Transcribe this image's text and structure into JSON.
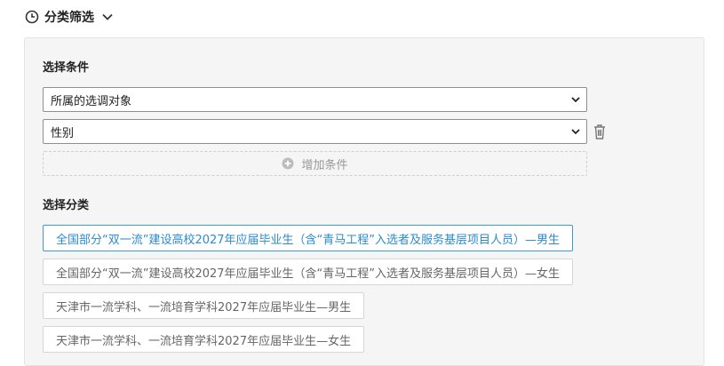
{
  "header": {
    "title": "分类筛选",
    "icon": "clock-icon",
    "toggle_icon": "chevron-down-icon"
  },
  "conditions": {
    "title": "选择条件",
    "selects": [
      {
        "value": "所属的选调对象"
      },
      {
        "value": "性别"
      }
    ],
    "add_label": "增加条件"
  },
  "categories": {
    "title": "选择分类",
    "items": [
      {
        "label": "全国部分“双一流”建设高校2027年应届毕业生（含“青马工程”入选者及服务基层项目人员）—男生",
        "selected": true
      },
      {
        "label": "全国部分“双一流”建设高校2027年应届毕业生（含“青马工程”入选者及服务基层项目人员）—女生",
        "selected": false
      },
      {
        "label": "天津市一流学科、一流培育学科2027年应届毕业生—男生",
        "selected": false
      },
      {
        "label": "天津市一流学科、一流培育学科2027年应届毕业生—女生",
        "selected": false
      }
    ]
  },
  "colors": {
    "accent": "#2a8bd0",
    "panel_bg": "#f5f5f5"
  }
}
